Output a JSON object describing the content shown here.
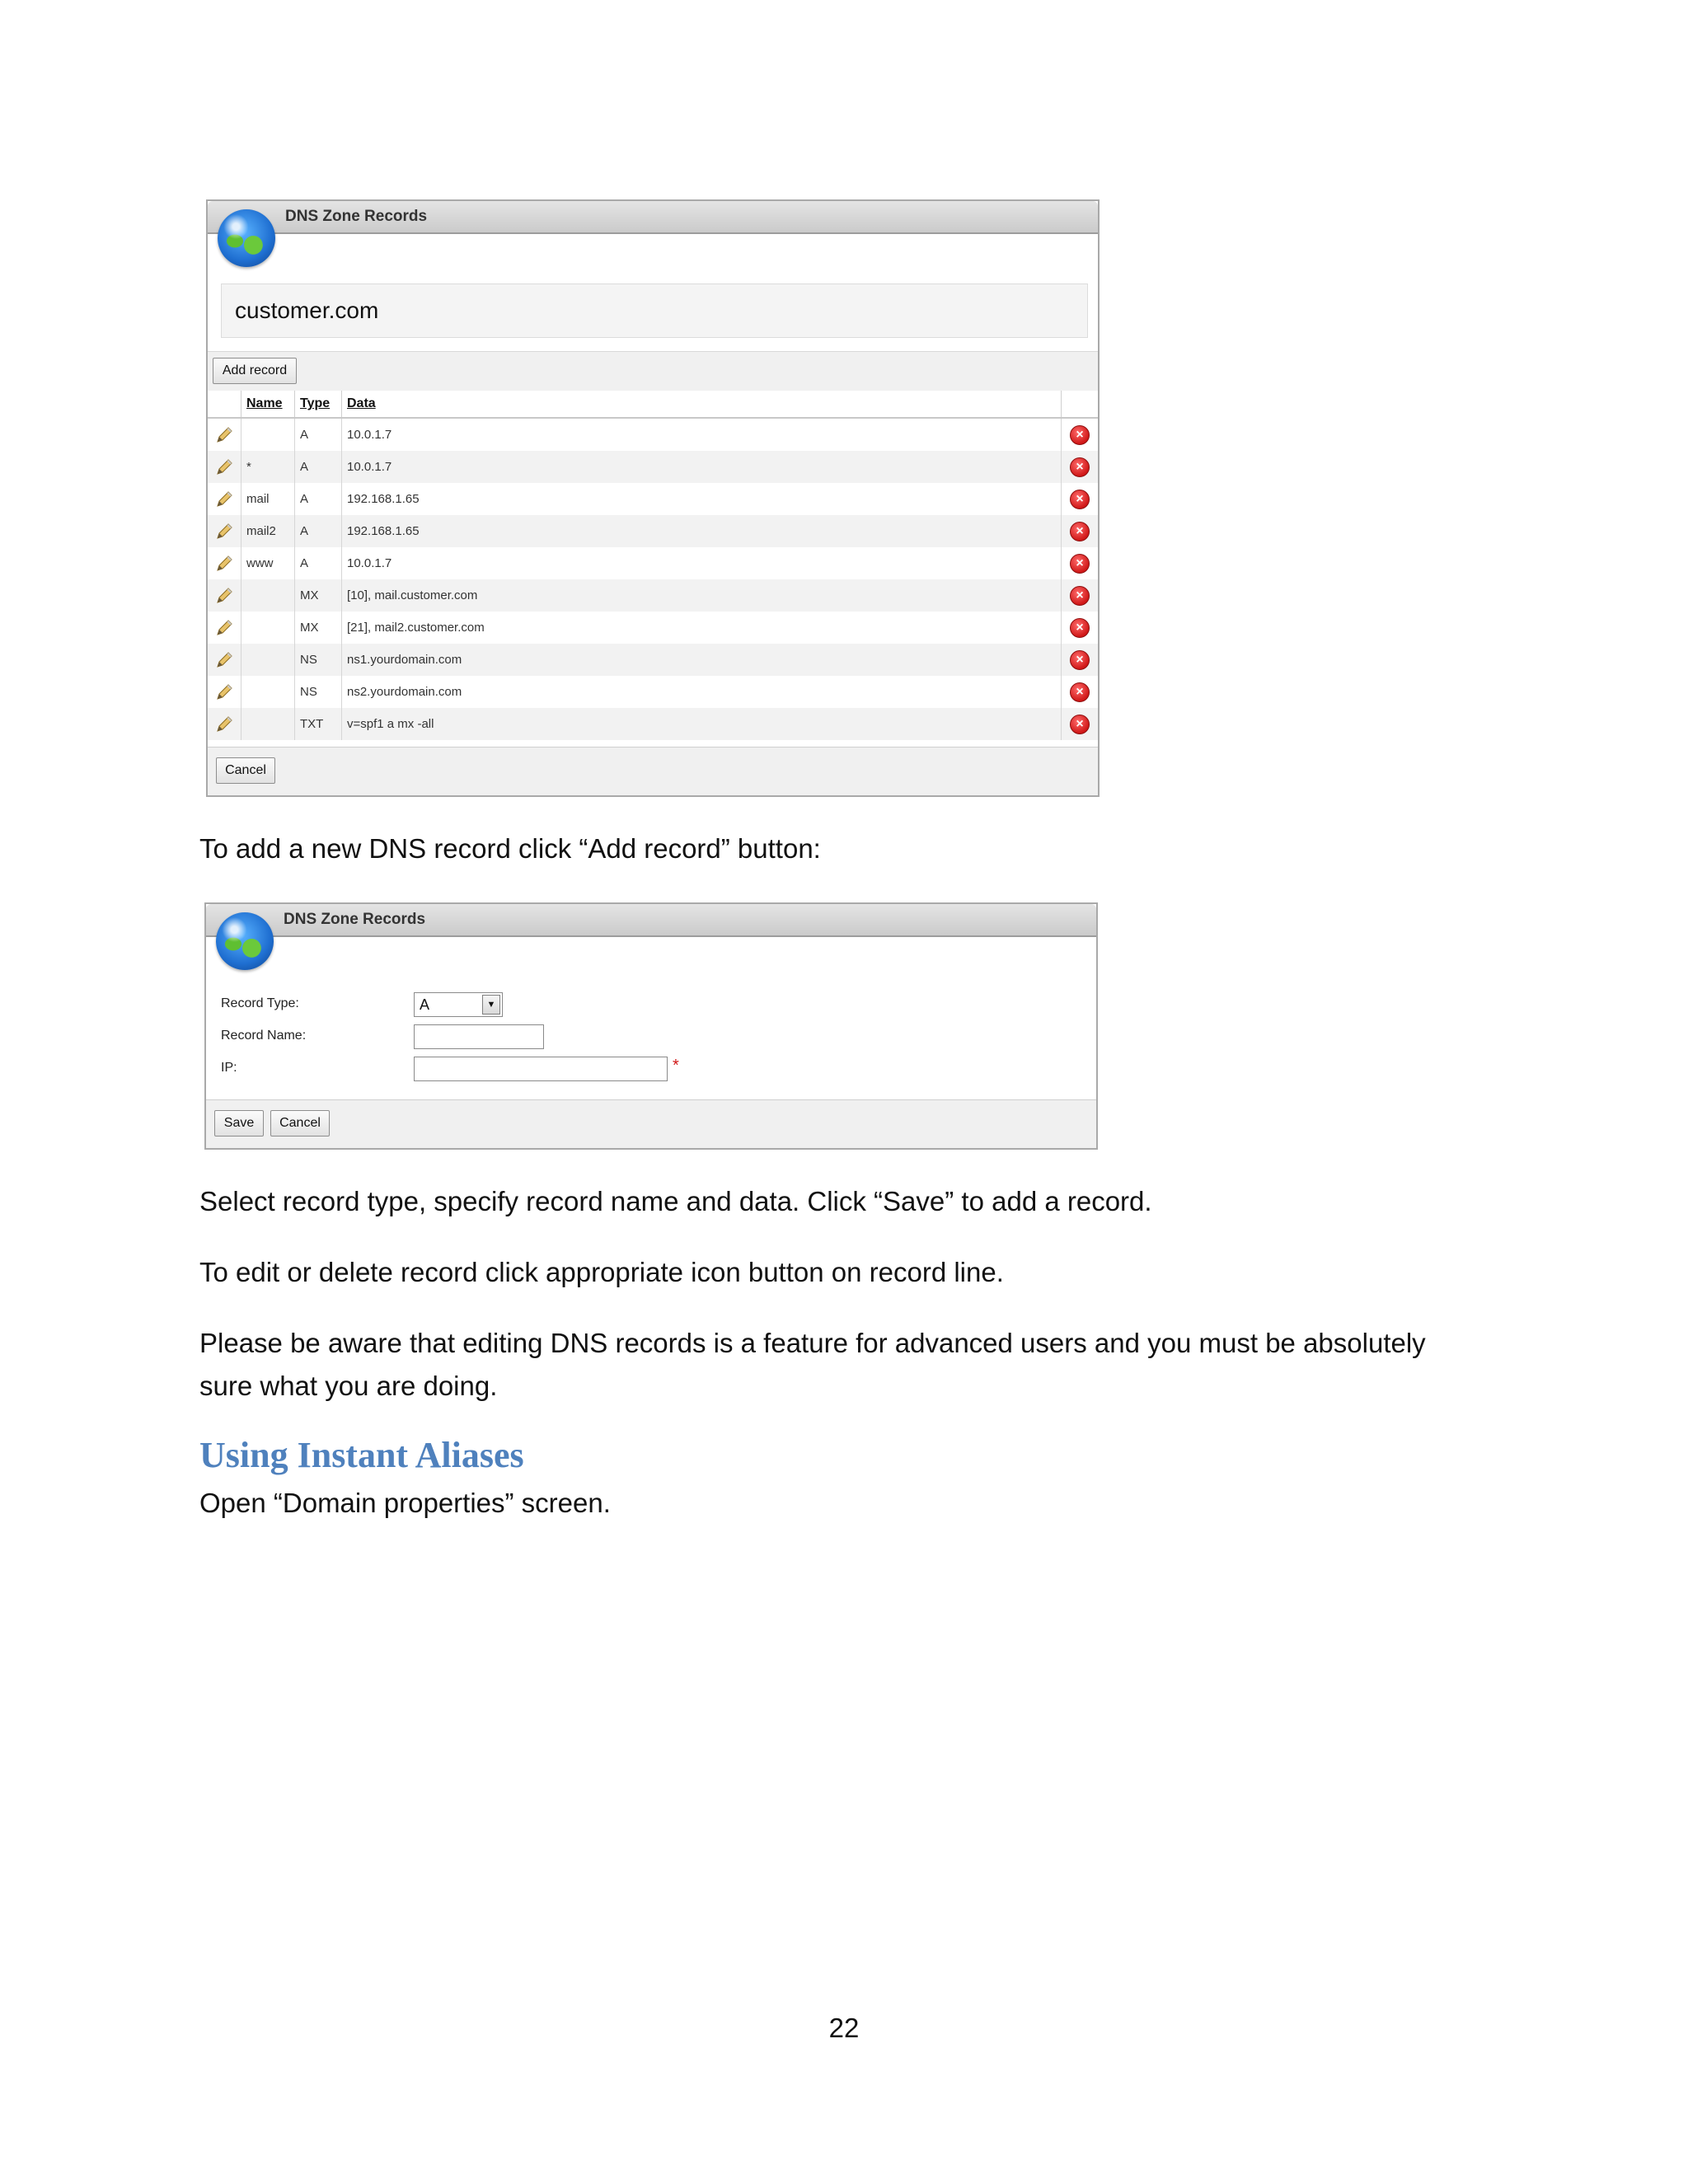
{
  "records_panel": {
    "title": "DNS Zone Records",
    "domain": "customer.com",
    "add_button": "Add record",
    "columns": {
      "name": "Name",
      "type": "Type",
      "data": "Data"
    },
    "rows": [
      {
        "name": "",
        "type": "A",
        "data": "10.0.1.7"
      },
      {
        "name": "*",
        "type": "A",
        "data": "10.0.1.7"
      },
      {
        "name": "mail",
        "type": "A",
        "data": "192.168.1.65"
      },
      {
        "name": "mail2",
        "type": "A",
        "data": "192.168.1.65"
      },
      {
        "name": "www",
        "type": "A",
        "data": "10.0.1.7"
      },
      {
        "name": "",
        "type": "MX",
        "data": "[10], mail.customer.com"
      },
      {
        "name": "",
        "type": "MX",
        "data": "[21], mail2.customer.com"
      },
      {
        "name": "",
        "type": "NS",
        "data": "ns1.yourdomain.com"
      },
      {
        "name": "",
        "type": "NS",
        "data": "ns2.yourdomain.com"
      },
      {
        "name": "",
        "type": "TXT",
        "data": "v=spf1 a mx -all"
      }
    ],
    "cancel_button": "Cancel"
  },
  "text1": "To add a new DNS record click “Add record” button:",
  "form_panel": {
    "title": "DNS Zone Records",
    "record_type_label": "Record Type:",
    "record_type_value": "A",
    "record_name_label": "Record Name:",
    "record_name_value": "",
    "ip_label": "IP:",
    "ip_value": "",
    "required_mark": "*",
    "save_button": "Save",
    "cancel_button": "Cancel"
  },
  "text2": "Select record type, specify record name and data. Click “Save” to add a record.",
  "text3": "To edit or delete record click appropriate icon button on record line.",
  "text4_line1": "Please be aware that editing DNS records is a feature for advanced users and you must be absolutely",
  "text4_line2": "sure what you are doing.",
  "heading": "Using Instant Aliases",
  "text5": "Open “Domain properties” screen.",
  "page_number": "22",
  "colors": {
    "heading": "#4f81bd",
    "delete": "#d01818",
    "globe": "#1f6fd1"
  },
  "icons": {
    "edit": "pencil-icon",
    "delete": "delete-icon",
    "logo": "globe-icon"
  }
}
